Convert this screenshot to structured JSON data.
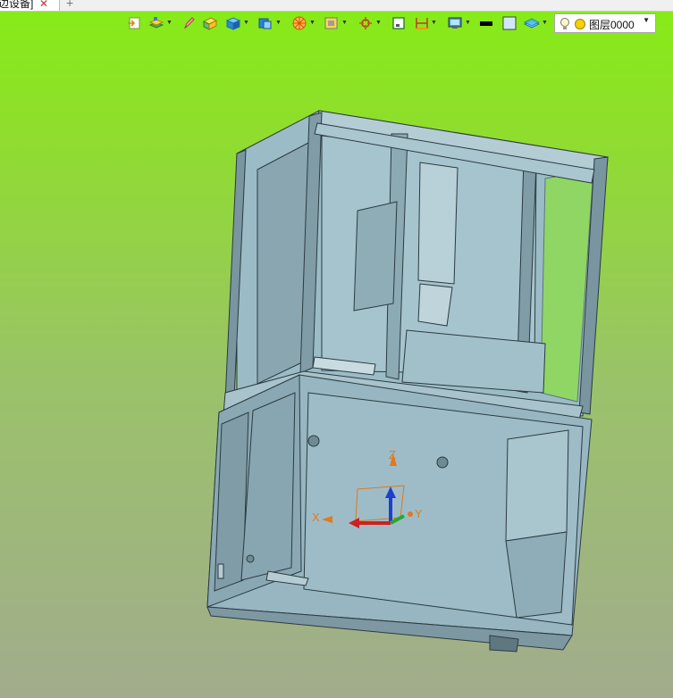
{
  "tab": {
    "title": "边设备]",
    "close_glyph": "✕",
    "add_glyph": "+"
  },
  "toolbar": {
    "tools": [
      "exit-sketch-icon",
      "layers-stack-icon",
      "pencil-icon",
      "box-tool-icon",
      "solid-view-icon",
      "view-cube-icon",
      "render-style-icon",
      "display-filter-icon",
      "snap-target-icon",
      "frame-select-icon",
      "dimension-icon",
      "monitor-view-icon",
      "color-black-icon",
      "color-light-icon",
      "layer-plane-icon"
    ],
    "layer_select": {
      "value": "图层0000",
      "icons": [
        "lightbulb-icon",
        "sun-icon"
      ]
    }
  },
  "viewport": {
    "background_top": "#86ec16",
    "background_bottom": "#a2ac8d",
    "model_color": "#98b8c4"
  },
  "triad": {
    "x_label": "X",
    "y_label": "Y",
    "z_label": "Z"
  }
}
